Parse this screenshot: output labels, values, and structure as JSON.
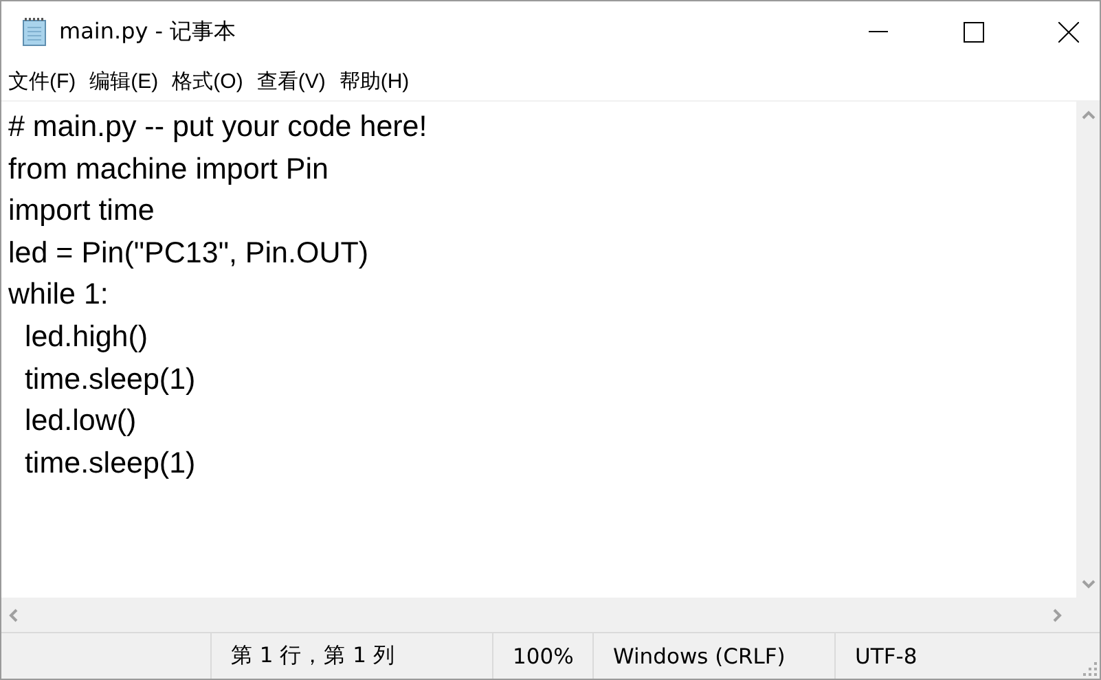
{
  "window": {
    "title": "main.py - 记事本"
  },
  "menu": [
    "文件(F)",
    "编辑(E)",
    "格式(O)",
    "查看(V)",
    "帮助(H)"
  ],
  "editor": {
    "lines": [
      "# main.py -- put your code here!",
      "from machine import Pin",
      "import time",
      "led = Pin(\"PC13\", Pin.OUT)",
      "while 1:",
      "  led.high()",
      "  time.sleep(1)",
      "  led.low()",
      "  time.sleep(1)"
    ]
  },
  "status_bar": [
    "第 1 行，第 1 列",
    "100%",
    "Windows (CRLF)",
    "UTF-8"
  ]
}
